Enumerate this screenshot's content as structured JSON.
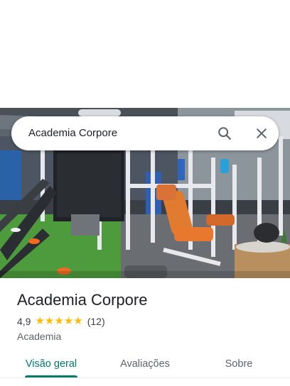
{
  "search": {
    "query": "Academia Corpore",
    "search_icon": "search-icon",
    "close_icon": "close-icon"
  },
  "place": {
    "name": "Academia Corpore",
    "rating": "4,9",
    "stars": 5,
    "review_count": "(12)",
    "category": "Academia"
  },
  "tabs": [
    {
      "label": "Visão geral",
      "active": true
    },
    {
      "label": "Avaliações",
      "active": false
    },
    {
      "label": "Sobre",
      "active": false
    }
  ],
  "colors": {
    "accent": "#00796b",
    "star": "#fbbc04"
  }
}
